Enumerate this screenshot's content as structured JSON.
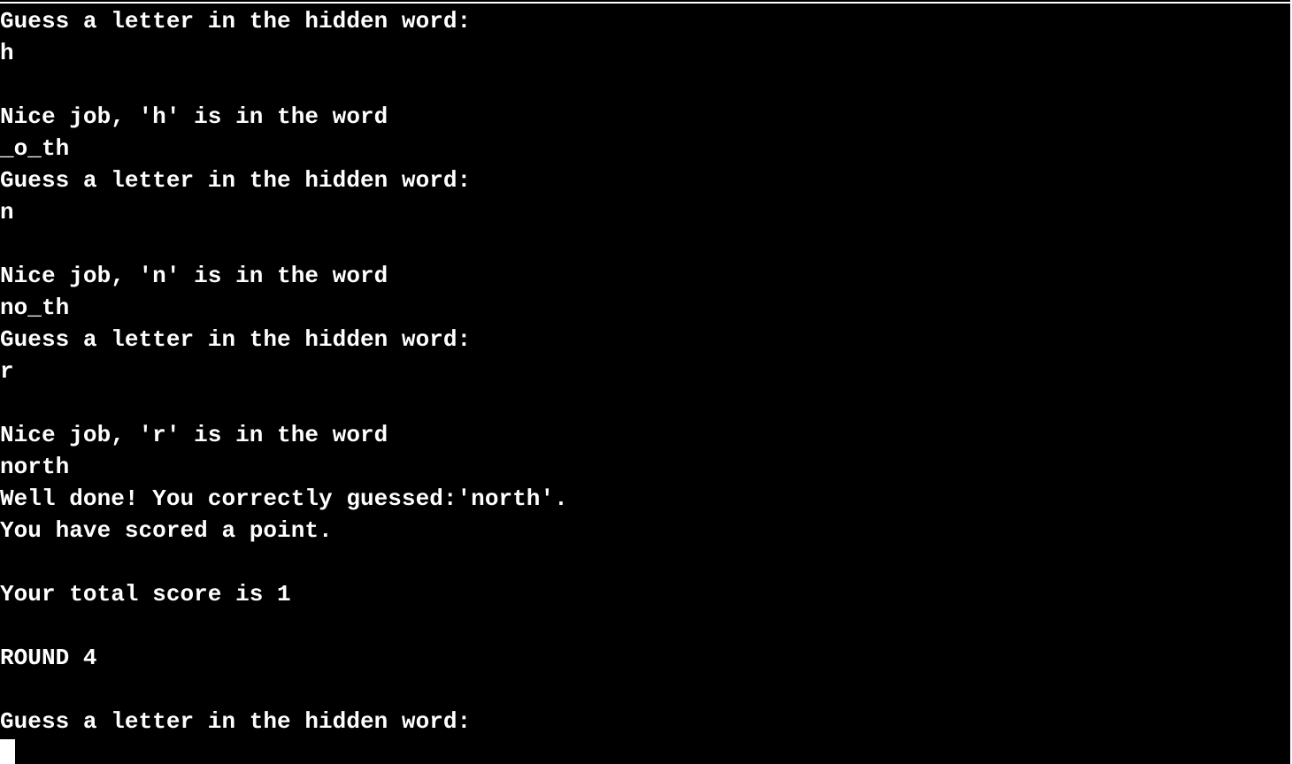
{
  "terminal": {
    "lines": [
      "Guess a letter in the hidden word:",
      "h",
      "",
      "Nice job, 'h' is in the word",
      "_o_th",
      "Guess a letter in the hidden word:",
      "n",
      "",
      "Nice job, 'n' is in the word",
      "no_th",
      "Guess a letter in the hidden word:",
      "r",
      "",
      "Nice job, 'r' is in the word",
      "north",
      "Well done! You correctly guessed:'north'.",
      "You have scored a point.",
      "",
      "Your total score is 1",
      "",
      "ROUND 4",
      "",
      "Guess a letter in the hidden word:"
    ]
  },
  "colors": {
    "background": "#000000",
    "text": "#ffffff",
    "cursor": "#ffffff"
  }
}
